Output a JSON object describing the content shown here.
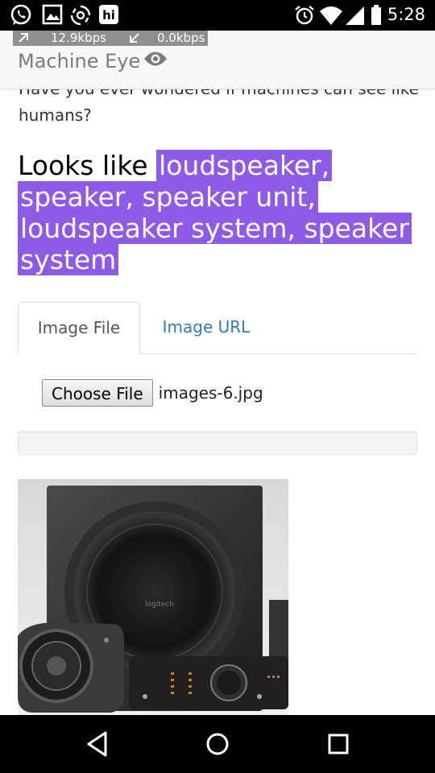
{
  "status_bar": {
    "time": "5:28",
    "left_icons": [
      "whatsapp-icon",
      "gallery-icon",
      "hotspot-icon",
      "hike-icon"
    ],
    "right_icons": [
      "alarm-icon",
      "wifi-icon",
      "signal-icon",
      "battery-icon"
    ]
  },
  "network_speed": {
    "upload": "12.9kbps",
    "download": "0.0kbps"
  },
  "header": {
    "title": "Machine Eye",
    "icon": "eye-icon"
  },
  "main": {
    "intro_text": "Have you ever wondered if machines can see like humans?",
    "result_prefix": "Looks like",
    "result_label": "loudspeaker, speaker, speaker unit, loudspeaker system, speaker system",
    "highlight_color": "#8e5ae8",
    "tabs": [
      {
        "label": "Image File",
        "active": true
      },
      {
        "label": "Image URL",
        "active": false
      }
    ],
    "file_input": {
      "button_label": "Choose File",
      "file_name": "images-6.jpg"
    },
    "progress": 0
  },
  "nav_bar": {
    "buttons": [
      "back-icon",
      "home-icon",
      "recents-icon"
    ]
  }
}
